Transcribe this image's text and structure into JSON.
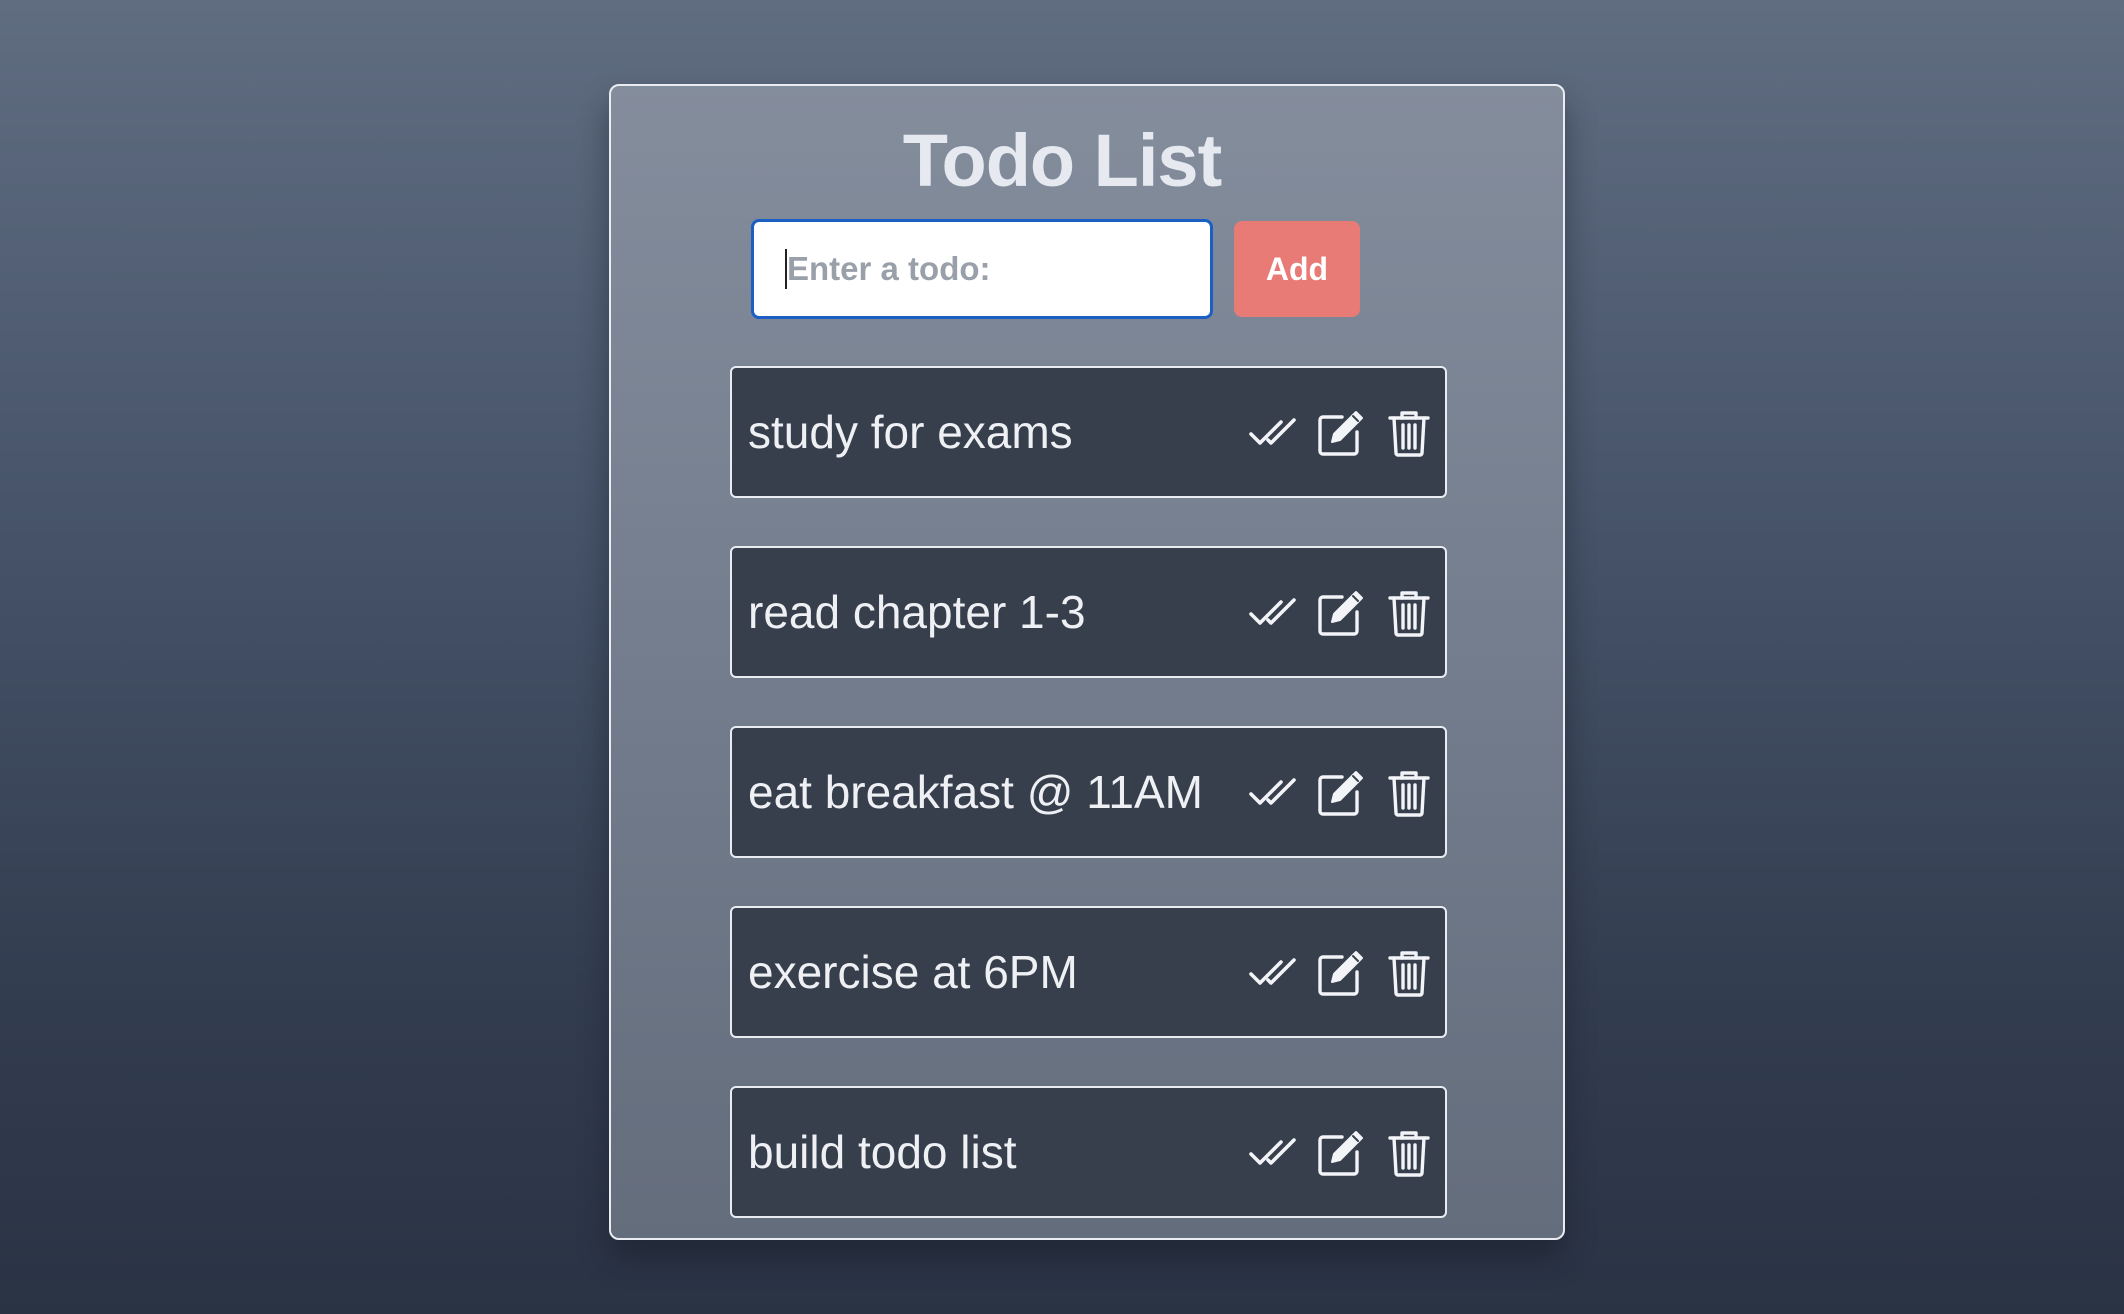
{
  "header": {
    "title": "Todo List"
  },
  "input": {
    "placeholder": "Enter a todo:",
    "value": ""
  },
  "add_button": {
    "label": "Add"
  },
  "todos": [
    {
      "text": "study for exams"
    },
    {
      "text": "read chapter 1-3"
    },
    {
      "text": "eat breakfast @ 11AM"
    },
    {
      "text": "exercise at 6PM"
    },
    {
      "text": "build todo list"
    }
  ],
  "icons": {
    "complete": "check-double-icon",
    "edit": "edit-icon",
    "delete": "trash-icon"
  },
  "colors": {
    "accent_button": "#e87b76",
    "item_background": "#373f4d",
    "input_focus": "#1b5fc4"
  }
}
